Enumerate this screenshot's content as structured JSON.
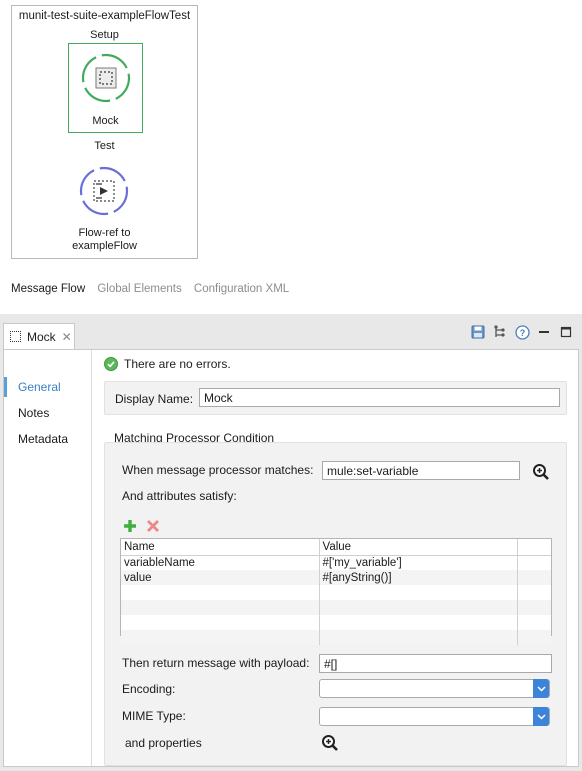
{
  "flow": {
    "title": "munit-test-suite-exampleFlowTest",
    "setup_label": "Setup",
    "mock_label": "Mock",
    "test_label": "Test",
    "flowref_label_line1": "Flow-ref to",
    "flowref_label_line2": "exampleFlow"
  },
  "editor_tabs": [
    "Message Flow",
    "Global Elements",
    "Configuration XML"
  ],
  "properties": {
    "tab_label": "Mock",
    "nav": [
      "General",
      "Notes",
      "Metadata"
    ],
    "status": "There are no errors.",
    "display_name_label": "Display Name:",
    "display_name_value": "Mock",
    "matching_title": "Matching Processor Condition",
    "when_label": "When message processor matches:",
    "when_value": "mule:set-variable",
    "attributes_label": "And attributes satisfy:",
    "table": {
      "headers": [
        "Name",
        "Value"
      ],
      "rows": [
        [
          "variableName",
          "#['my_variable']"
        ],
        [
          "value",
          "#[anyString()]"
        ]
      ]
    },
    "payload_label": "Then return message with payload:",
    "payload_value": "#[]",
    "encoding_label": "Encoding:",
    "encoding_value": "",
    "mime_label": "MIME Type:",
    "mime_value": "",
    "properties_label": "and properties"
  },
  "colors": {
    "mock_accent": "#41ab5d",
    "flowref_accent": "#6a6fd8",
    "nav_active": "#3a7fc4",
    "select_arrow": "#3c84d8"
  }
}
